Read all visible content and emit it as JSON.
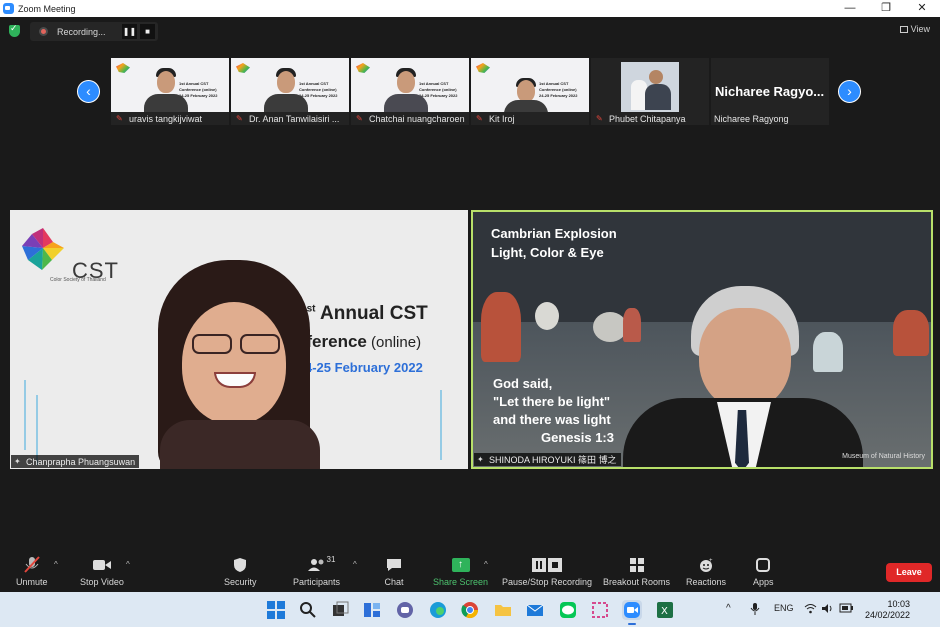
{
  "window": {
    "title": "Zoom Meeting",
    "minimize": "—",
    "maximize": "❐",
    "close": "✕"
  },
  "recording": {
    "status": "Recording...",
    "pause": "❚❚",
    "stop": "■"
  },
  "view_label": "View",
  "participants_strip": [
    {
      "name": "uravis tangkijviwat",
      "muted": true,
      "kind": "slide"
    },
    {
      "name": "Dr. Anan Tanwilaisiri ...",
      "muted": true,
      "kind": "slide"
    },
    {
      "name": "Chatchai nuangcharoen",
      "muted": true,
      "kind": "slide"
    },
    {
      "name": "Kit Iroj",
      "muted": true,
      "kind": "slide"
    },
    {
      "name": "Phubet Chitapanya",
      "muted": true,
      "kind": "photo"
    },
    {
      "name": "Nicharee Ragyong",
      "display_name": "Nicharee Ragyo...",
      "muted": false,
      "kind": "text"
    }
  ],
  "thumb_slide_text": [
    "1st Annual CST",
    "Conference (online)",
    "24-25 February 2022"
  ],
  "main_left": {
    "name": "Chanprapha Phuangsuwan",
    "logo_text": "CST",
    "logo_sub": "Color Society of Thailand",
    "slide_line1": "1",
    "slide_line1_sup": "st",
    "slide_line1_rest": " Annual CST",
    "slide_line2": "nference",
    "slide_line2_paren": " (online)",
    "slide_line3": "4-25 February 2022"
  },
  "main_right": {
    "name": "SHINODA HIROYUKI 篠田 博之",
    "title_line1": "Cambrian Explosion",
    "title_line2": "Light, Color & Eye",
    "quote": [
      "God said,",
      "\"Let there be light\"",
      "and there was light",
      "Genesis 1:3"
    ],
    "credit": "Museum of Natural History"
  },
  "toolbar": {
    "unmute": "Unmute",
    "stop_video": "Stop Video",
    "security": "Security",
    "participants": "Participants",
    "participant_count": "31",
    "chat": "Chat",
    "share_screen": "Share Screen",
    "pause_stop_recording": "Pause/Stop Recording",
    "breakout_rooms": "Breakout Rooms",
    "reactions": "Reactions",
    "apps": "Apps",
    "leave": "Leave"
  },
  "taskbar": {
    "lang": "ENG",
    "time": "10:03",
    "date": "24/02/2022",
    "caret": "^"
  },
  "colors": {
    "zoom_blue": "#2d8cff",
    "active_speaker_border": "#b8e06a",
    "share_green": "#2fb35b",
    "leave_red": "#e02828"
  }
}
